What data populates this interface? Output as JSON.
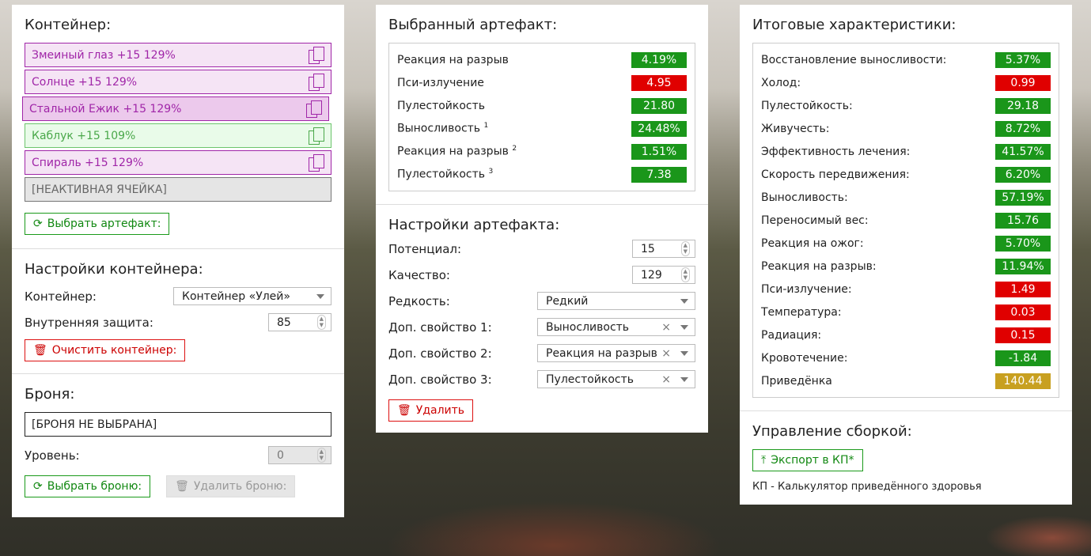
{
  "colors": {
    "good": "#1a961a",
    "bad": "#e00000",
    "neutral": "#c8a020",
    "accent": "#a026a8"
  },
  "container": {
    "title": "Контейнер:",
    "slots": [
      {
        "label": "Змеиный глаз +15 129%",
        "icon": "copy-icon"
      },
      {
        "label": "Солнце +15 129%",
        "icon": "copy-icon"
      },
      {
        "label": "Стальной Ежик +15 129%",
        "icon": "copy-icon"
      },
      {
        "label": "Каблук +15 109%",
        "icon": "copy-icon"
      },
      {
        "label": "Спираль +15 129%",
        "icon": "copy-icon"
      },
      {
        "label": "[НЕАКТИВНАЯ ЯЧЕЙКА]"
      }
    ],
    "select_button": "Выбрать артефакт:"
  },
  "container_settings": {
    "title": "Настройки контейнера:",
    "container_label": "Контейнер:",
    "container_value": "Контейнер «Улей»",
    "protection_label": "Внутренняя защита:",
    "protection_value": "85",
    "clear_button": "Очистить контейнер:"
  },
  "armor": {
    "title": "Броня:",
    "value": "[БРОНЯ НЕ ВЫБРАНА]",
    "level_label": "Уровень:",
    "level_value": "0",
    "select_button": "Выбрать броню:",
    "remove_button": "Удалить броню:"
  },
  "selected_artifact": {
    "title": "Выбранный артефакт:",
    "stats": [
      {
        "name": "Реакция на разрыв",
        "sup": "",
        "value": "4.19%",
        "color": "g"
      },
      {
        "name": "Пси-излучение",
        "sup": "",
        "value": "4.95",
        "color": "r"
      },
      {
        "name": "Пулестойкость",
        "sup": "",
        "value": "21.80",
        "color": "g"
      },
      {
        "name": "Выносливость",
        "sup": "1",
        "value": "24.48%",
        "color": "g"
      },
      {
        "name": "Реакция на разрыв",
        "sup": "2",
        "value": "1.51%",
        "color": "g"
      },
      {
        "name": "Пулестойкость",
        "sup": "3",
        "value": "7.38",
        "color": "g"
      }
    ]
  },
  "artifact_settings": {
    "title": "Настройки артефакта:",
    "potential_label": "Потенциал:",
    "potential_value": "15",
    "quality_label": "Качество:",
    "quality_value": "129",
    "rarity_label": "Редкость:",
    "rarity_value": "Редкий",
    "extra1_label": "Доп. свойство 1:",
    "extra1_value": "Выносливость",
    "extra2_label": "Доп. свойство 2:",
    "extra2_value": "Реакция на разрыв",
    "extra3_label": "Доп. свойство 3:",
    "extra3_value": "Пулестойкость",
    "delete_button": "Удалить"
  },
  "totals": {
    "title": "Итоговые характеристики:",
    "stats": [
      {
        "name": "Восстановление выносливости:",
        "value": "5.37%",
        "color": "g"
      },
      {
        "name": "Холод:",
        "value": "0.99",
        "color": "r"
      },
      {
        "name": "Пулестойкость:",
        "value": "29.18",
        "color": "g"
      },
      {
        "name": "Живучесть:",
        "value": "8.72%",
        "color": "g"
      },
      {
        "name": "Эффективность лечения:",
        "value": "41.57%",
        "color": "g"
      },
      {
        "name": "Скорость передвижения:",
        "value": "6.20%",
        "color": "g"
      },
      {
        "name": "Выносливость:",
        "value": "57.19%",
        "color": "g"
      },
      {
        "name": "Переносимый вес:",
        "value": "15.76",
        "color": "g"
      },
      {
        "name": "Реакция на ожог:",
        "value": "5.70%",
        "color": "g"
      },
      {
        "name": "Реакция на разрыв:",
        "value": "11.94%",
        "color": "g"
      },
      {
        "name": "Пси-излучение:",
        "value": "1.49",
        "color": "r"
      },
      {
        "name": "Температура:",
        "value": "0.03",
        "color": "r"
      },
      {
        "name": "Радиация:",
        "value": "0.15",
        "color": "r"
      },
      {
        "name": "Кровотечение:",
        "value": "-1.84",
        "color": "g"
      },
      {
        "name": "Приведёнка",
        "value": "140.44",
        "color": "y"
      }
    ]
  },
  "build": {
    "title": "Управление сборкой:",
    "export_button": "Экспорт в КП*",
    "footnote": "КП - Калькулятор приведённого здоровья"
  }
}
